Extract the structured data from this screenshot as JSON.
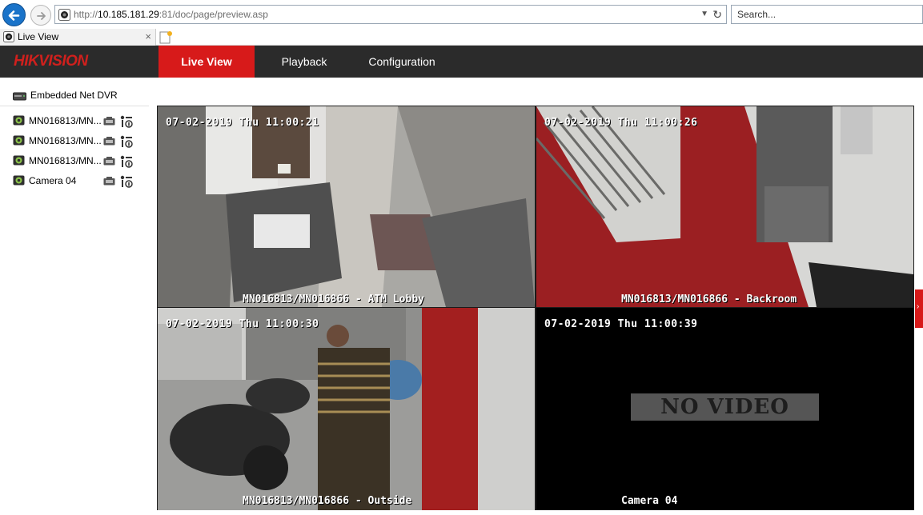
{
  "browser": {
    "url_prefix": "http://",
    "url_host": "10.185.181.29",
    "url_rest": ":81/doc/page/preview.asp",
    "search_placeholder": "Search...",
    "tab_title": "Live View",
    "tab_close": "×"
  },
  "header": {
    "logo_hik": "HIK",
    "logo_vision": "VISION",
    "nav": {
      "live": "Live View",
      "playback": "Playback",
      "configuration": "Configuration"
    },
    "active_color": "#d71a1a"
  },
  "sidebar": {
    "device": "Embedded Net DVR",
    "cameras": [
      {
        "label": "MN016813/MN..."
      },
      {
        "label": "MN016813/MN..."
      },
      {
        "label": "MN016813/MN..."
      },
      {
        "label": "Camera 04"
      }
    ]
  },
  "video": {
    "cells": [
      {
        "timestamp": "07-02-2019 Thu 11:00:21",
        "name": "MN016813/MN016866 - ATM Lobby",
        "selected": true
      },
      {
        "timestamp": "07-02-2019 Thu 11:00:26",
        "name": "MN016813/MN016866 - Backroom",
        "selected": false
      },
      {
        "timestamp": "07-02-2019 Thu 11:00:30",
        "name": "MN016813/MN016866 - Outside",
        "selected": false
      },
      {
        "timestamp": "07-02-2019 Thu 11:00:39",
        "name": "Camera 04",
        "selected": false,
        "status": "NO VIDEO"
      }
    ]
  },
  "icons": {
    "back": "arrow-left-icon",
    "forward": "arrow-right-icon",
    "refresh": "refresh-icon",
    "dvr": "dvr-icon",
    "camera": "camera-icon",
    "record": "record-icon",
    "ptz": "ptz-icon"
  }
}
